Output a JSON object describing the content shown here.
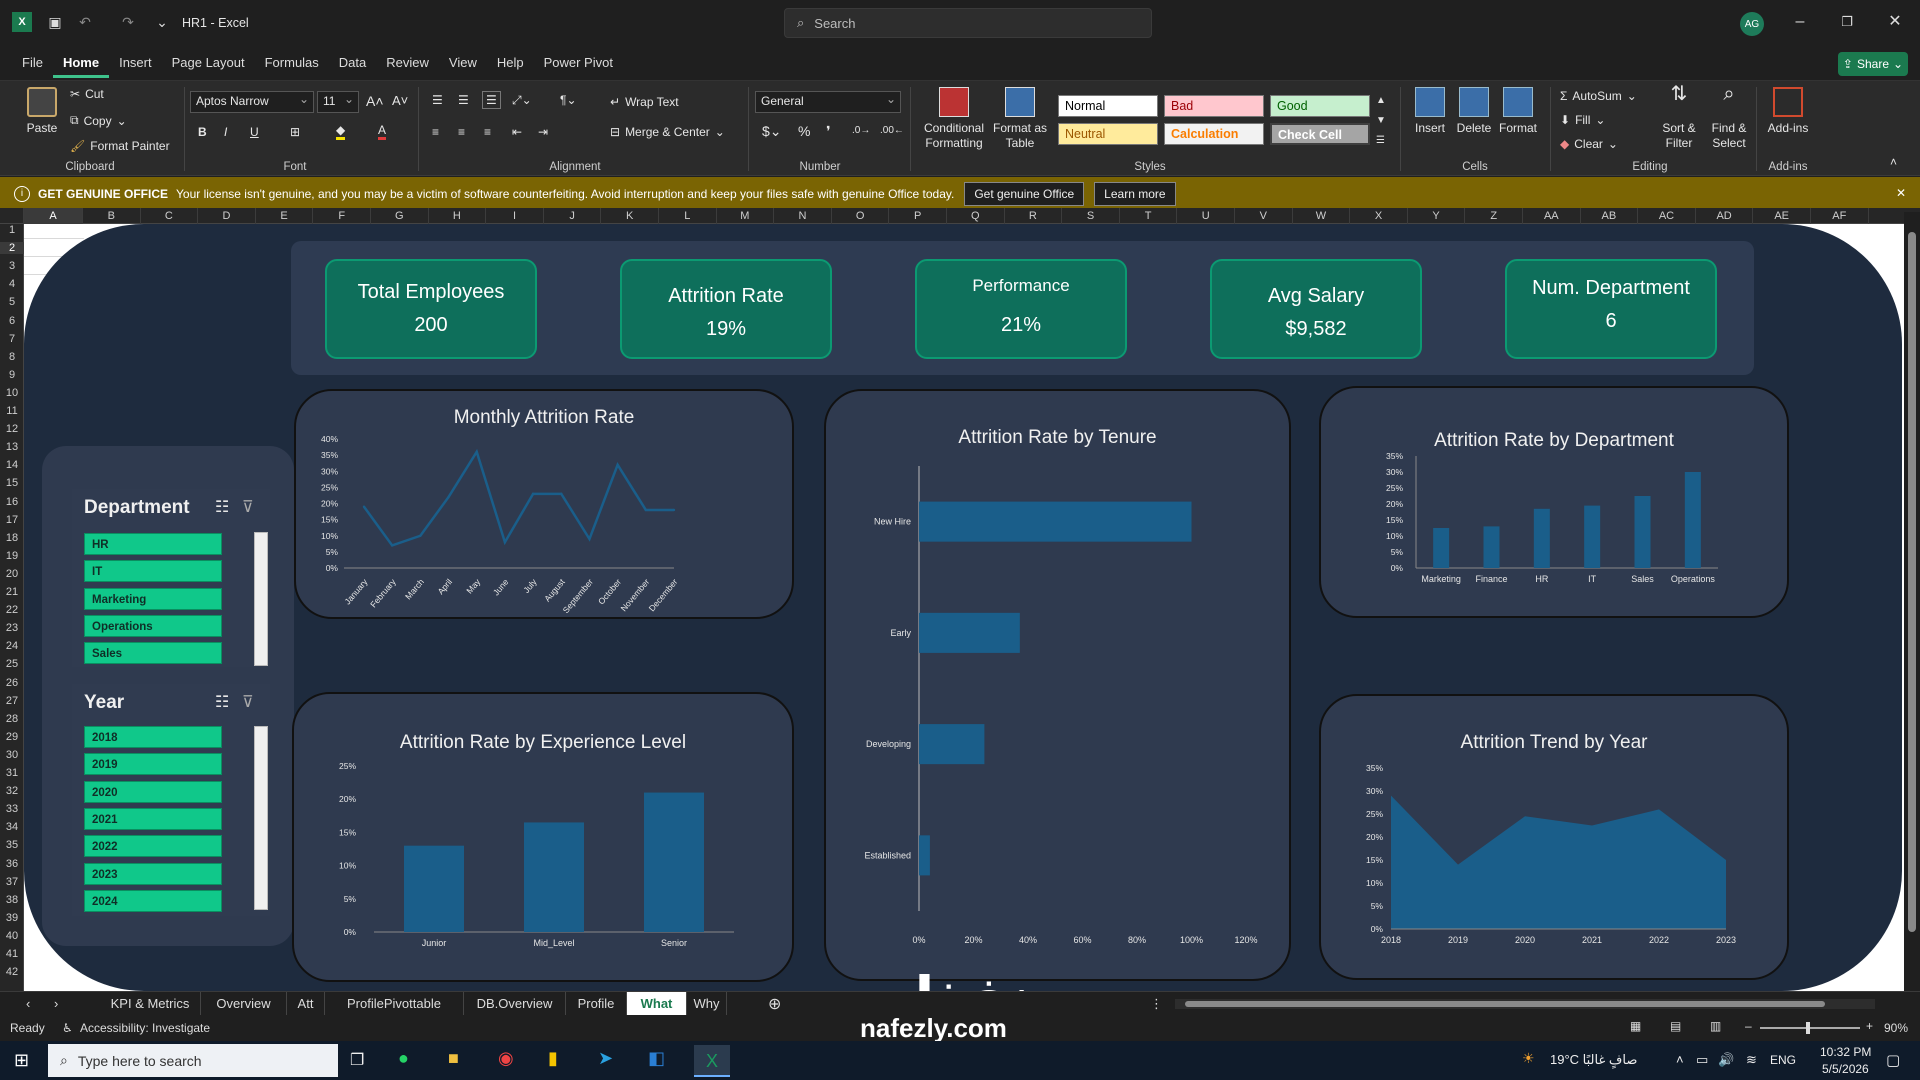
{
  "titlebar": {
    "title": "HR1 - Excel",
    "search_placeholder": "Search",
    "avatar_initials": "AG"
  },
  "menu": {
    "tabs": [
      "File",
      "Home",
      "Insert",
      "Page Layout",
      "Formulas",
      "Data",
      "Review",
      "View",
      "Help",
      "Power Pivot"
    ],
    "active": "Home",
    "share": "Share"
  },
  "ribbon": {
    "clipboard": {
      "paste": "Paste",
      "cut": "Cut",
      "copy": "Copy",
      "format_painter": "Format Painter",
      "label": "Clipboard"
    },
    "font": {
      "name": "Aptos Narrow",
      "size": "11",
      "label": "Font"
    },
    "alignment": {
      "wrap": "Wrap Text",
      "merge": "Merge & Center",
      "label": "Alignment"
    },
    "number": {
      "format": "General",
      "label": "Number"
    },
    "styles": {
      "cond": "Conditional Formatting",
      "table": "Format as Table",
      "normal": "Normal",
      "bad": "Bad",
      "good": "Good",
      "neutral": "Neutral",
      "calc": "Calculation",
      "check": "Check Cell",
      "label": "Styles"
    },
    "cells": {
      "insert": "Insert",
      "delete": "Delete",
      "format": "Format",
      "label": "Cells"
    },
    "editing": {
      "autosum": "AutoSum",
      "fill": "Fill",
      "clear": "Clear",
      "sort": "Sort & Filter",
      "find": "Find & Select",
      "label": "Editing"
    },
    "addins": {
      "addins": "Add-ins",
      "label": "Add-ins"
    }
  },
  "notification": {
    "title": "GET GENUINE OFFICE",
    "message": "Your license isn't genuine, and you may be a victim of software counterfeiting. Avoid interruption and keep your files safe with genuine Office today.",
    "btn_genuine": "Get genuine Office",
    "btn_learn": "Learn more"
  },
  "columns": [
    "A",
    "B",
    "C",
    "D",
    "E",
    "F",
    "G",
    "H",
    "I",
    "J",
    "K",
    "L",
    "M",
    "N",
    "O",
    "P",
    "Q",
    "R",
    "S",
    "T",
    "U",
    "V",
    "W",
    "X",
    "Y",
    "Z",
    "AA",
    "AB",
    "AC",
    "AD",
    "AE",
    "AF"
  ],
  "kpis": [
    {
      "label": "Total Employees",
      "value": "200"
    },
    {
      "label": "Attrition Rate",
      "value": "19%"
    },
    {
      "label": "Performance",
      "value": "21%"
    },
    {
      "label": "Avg Salary",
      "value": "$9,582"
    },
    {
      "label": "Num. Department",
      "value": "6"
    }
  ],
  "slicers": {
    "department": {
      "title": "Department",
      "items": [
        "HR",
        "IT",
        "Marketing",
        "Operations",
        "Sales"
      ]
    },
    "year": {
      "title": "Year",
      "items": [
        "2018",
        "2019",
        "2020",
        "2021",
        "2022",
        "2023",
        "2024"
      ]
    }
  },
  "colors": {
    "accent": "#10c88a",
    "bar": "#1a5e8a",
    "card": "#2f3a4f",
    "bg": "#1e2b3e"
  },
  "chart_data": [
    {
      "type": "line",
      "title": "Monthly Attrition Rate",
      "categories": [
        "January",
        "February",
        "March",
        "April",
        "May",
        "June",
        "July",
        "August",
        "September",
        "October",
        "November",
        "December"
      ],
      "values": [
        19,
        7,
        10,
        22,
        36,
        8,
        23,
        23,
        9,
        32,
        18,
        18
      ],
      "ylim": [
        0,
        40
      ],
      "yticks": [
        "0%",
        "5%",
        "10%",
        "15%",
        "20%",
        "25%",
        "30%",
        "35%",
        "40%"
      ]
    },
    {
      "type": "bar",
      "orientation": "horizontal",
      "title": "Attrition Rate by Tenure",
      "categories": [
        "New Hire",
        "Early",
        "Developing",
        "Established"
      ],
      "values": [
        100,
        37,
        24,
        4
      ],
      "xlim": [
        0,
        120
      ],
      "xticks": [
        "0%",
        "20%",
        "40%",
        "60%",
        "80%",
        "100%",
        "120%"
      ]
    },
    {
      "type": "bar",
      "title": "Attrition Rate by Department",
      "categories": [
        "Marketing",
        "Finance",
        "HR",
        "IT",
        "Sales",
        "Operations"
      ],
      "values": [
        12.5,
        13,
        18.5,
        19.5,
        22.5,
        30
      ],
      "ylim": [
        0,
        35
      ],
      "yticks": [
        "0%",
        "5%",
        "10%",
        "15%",
        "20%",
        "25%",
        "30%",
        "35%"
      ]
    },
    {
      "type": "bar",
      "title": "Attrition Rate by Experience Level",
      "categories": [
        "Junior",
        "Mid_Level",
        "Senior"
      ],
      "values": [
        13,
        16.5,
        21
      ],
      "ylim": [
        0,
        25
      ],
      "yticks": [
        "0%",
        "5%",
        "10%",
        "15%",
        "20%",
        "25%"
      ]
    },
    {
      "type": "area",
      "title": "Attrition Trend by Year",
      "categories": [
        "2018",
        "2019",
        "2020",
        "2021",
        "2022",
        "2023"
      ],
      "values": [
        29,
        14,
        24.5,
        22.5,
        26,
        15
      ],
      "ylim": [
        0,
        35
      ],
      "yticks": [
        "0%",
        "5%",
        "10%",
        "15%",
        "20%",
        "25%",
        "30%",
        "35%"
      ]
    }
  ],
  "sheet_tabs": [
    "KPI & Metrics",
    "Overview",
    "Att",
    "ProfilePivottable",
    "DB.Overview",
    "Profile",
    "What",
    "Why"
  ],
  "active_sheet": "What",
  "status": {
    "ready": "Ready",
    "accessibility": "Accessibility: Investigate",
    "zoom": "90%"
  },
  "taskbar": {
    "search": "Type here to search",
    "weather": "19°C  صافٍ غالبًا",
    "lang": "ENG",
    "time": "10:32 PM",
    "date": "5/5/2026"
  },
  "watermark": {
    "arabic": "نفذلي",
    "latin": "nafezly.com"
  }
}
